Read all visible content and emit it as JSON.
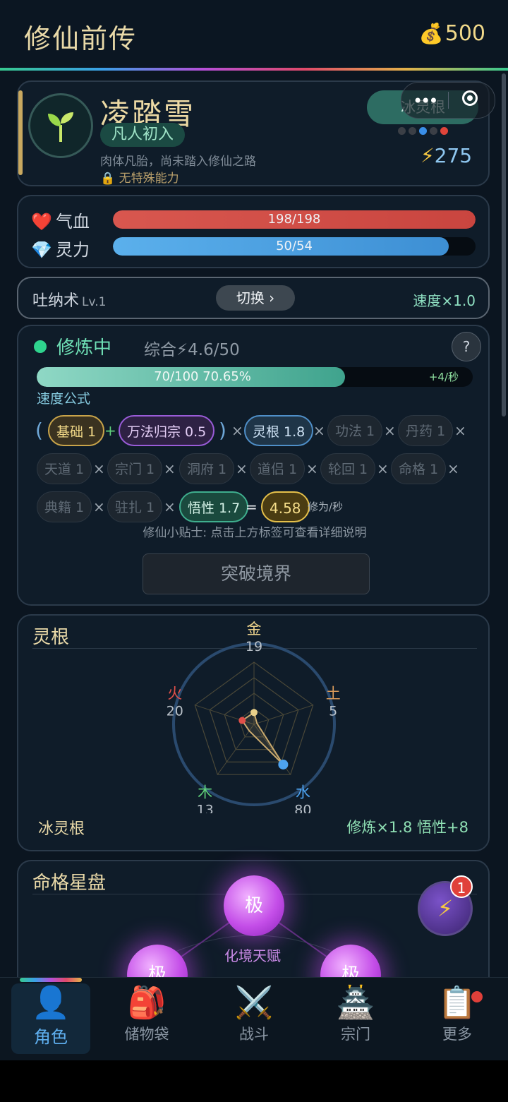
{
  "header": {
    "title": "修仙前传",
    "gold": "500",
    "gold_icon": "money-bag-icon"
  },
  "profile": {
    "name": "凌踏雪",
    "realm": "凡人初入",
    "description": "肉体凡胎，尚未踏入修仙之路",
    "ability": "无特殊能力",
    "root_label": "冰灵根",
    "power": "275",
    "root_dot_colors": [
      "#3b3f46",
      "#3b3f46",
      "#3a8fe8",
      "#3b3f46",
      "#e0443a"
    ]
  },
  "stats": {
    "hp_label": "气血",
    "hp_text": "198/198",
    "hp_fraction": 1.0,
    "mp_label": "灵力",
    "mp_text": "50/54",
    "mp_fraction": 0.926
  },
  "technique": {
    "name": "吐纳术",
    "level": "Lv.1",
    "switch_label": "切换 ›",
    "speed": "速度×1.0"
  },
  "cultivation": {
    "status": "修炼中",
    "summary": "综合⚡4.6/50",
    "help": "?",
    "progress_text": "70/100  70.65%",
    "progress_fraction": 0.7065,
    "rate": "+4/秒",
    "formula_label": "速度公式",
    "chips": {
      "base": "基础 1",
      "wanfa": "万法归宗 0.5",
      "root": "灵根 1.8",
      "gongfa": "功法 1",
      "danyao": "丹药 1",
      "tiandao": "天道 1",
      "zongmen": "宗门 1",
      "dongfu": "洞府 1",
      "daolv": "道侣 1",
      "lunhui": "轮回 1",
      "mingge": "命格 1",
      "dianji": "典籍 1",
      "zhuzha": "驻扎 1",
      "wuxing": "悟性 1.7",
      "result": "4.58",
      "unit": "修为/秒"
    },
    "ops": {
      "open": "(",
      "plus": "+",
      "close": ")",
      "times": "×",
      "equals": "="
    },
    "tip": "修仙小贴士: 点击上方标签可查看详细说明",
    "breakthrough": "突破境界"
  },
  "spirit_root": {
    "title": "灵根",
    "elements": [
      {
        "name": "金",
        "value": "19",
        "color": "#e9d08a"
      },
      {
        "name": "土",
        "value": "5",
        "color": "#d99a5a"
      },
      {
        "name": "水",
        "value": "80",
        "color": "#4da3f0"
      },
      {
        "name": "木",
        "value": "13",
        "color": "#5fd07a"
      },
      {
        "name": "火",
        "value": "20",
        "color": "#e0504a"
      }
    ],
    "root_name": "冰灵根",
    "bonus": "修炼×1.8  悟性+8"
  },
  "destiny": {
    "title": "命格星盘",
    "orb_top": "极",
    "orb_left": "极",
    "orb_right": "极",
    "orb_label": "化境天赋"
  },
  "float_button": {
    "badge": "1",
    "icon": "lightning-icon"
  },
  "nav": [
    {
      "label": "角色",
      "icon": "👤"
    },
    {
      "label": "储物袋",
      "icon": "🎒"
    },
    {
      "label": "战斗",
      "icon": "⚔️"
    },
    {
      "label": "宗门",
      "icon": "🏯"
    },
    {
      "label": "更多",
      "icon": "📋"
    }
  ]
}
